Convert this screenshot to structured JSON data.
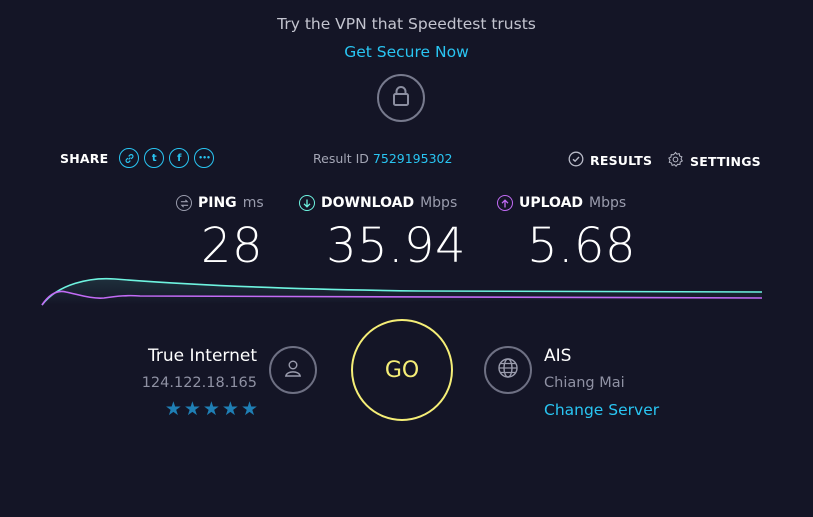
{
  "promo": {
    "text": "Try the VPN that Speedtest trusts",
    "cta": "Get Secure Now",
    "lock_icon": "lock-icon"
  },
  "share": {
    "label": "SHARE",
    "icons": [
      "link-icon",
      "twitter-icon",
      "facebook-icon",
      "more-icon"
    ],
    "twitter_glyph": "t",
    "facebook_glyph": "f",
    "more_glyph": "•••"
  },
  "result": {
    "label": "Result ID",
    "id": "7529195302"
  },
  "top_actions": {
    "results_label": "RESULTS",
    "results_icon": "check-circle-icon",
    "settings_label": "SETTINGS",
    "settings_icon": "gear-icon"
  },
  "metrics": {
    "ping": {
      "label": "PING",
      "unit": "ms",
      "value": "28",
      "icon": "ping-icon",
      "color": "#9a9cad"
    },
    "download": {
      "label": "DOWNLOAD",
      "unit": "Mbps",
      "value": "35.94",
      "icon": "download-arrow-icon",
      "color": "#6ef4e0"
    },
    "upload": {
      "label": "UPLOAD",
      "unit": "Mbps",
      "value": "5.68",
      "icon": "upload-arrow-icon",
      "color": "#c26bf5"
    }
  },
  "isp": {
    "name": "True Internet",
    "ip": "124.122.18.165",
    "stars": "★★★★★",
    "rating": 5,
    "icon": "user-icon"
  },
  "go_button": {
    "label": "GO",
    "color": "#f5ee77"
  },
  "server": {
    "name": "AIS",
    "location": "Chiang Mai",
    "change_label": "Change Server",
    "icon": "globe-icon"
  },
  "colors": {
    "background": "#141526",
    "accent": "#29c5f2",
    "download_line": "#6ef4e0",
    "upload_line": "#c26bf5"
  }
}
